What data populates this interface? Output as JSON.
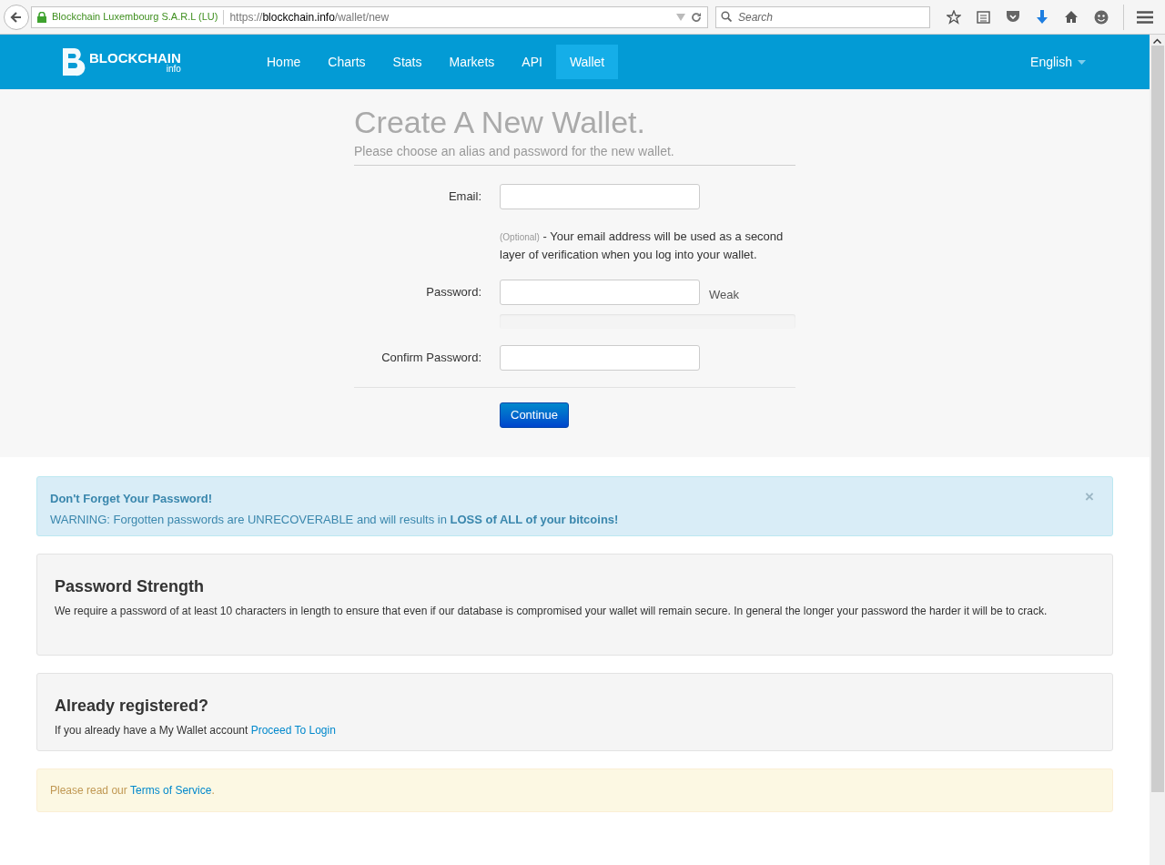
{
  "browser": {
    "identity": "Blockchain Luxembourg S.A.R.L (LU)",
    "url": {
      "scheme": "https://",
      "host": "blockchain.info",
      "path": "/wallet/new"
    },
    "search": {
      "placeholder": "Search"
    }
  },
  "navbar": {
    "logo": {
      "name": "BLOCKCHAIN",
      "sub": "info"
    },
    "items": [
      {
        "label": "Home",
        "selected": false
      },
      {
        "label": "Charts",
        "selected": false
      },
      {
        "label": "Stats",
        "selected": false
      },
      {
        "label": "Markets",
        "selected": false
      },
      {
        "label": "API",
        "selected": false
      },
      {
        "label": "Wallet",
        "selected": true
      }
    ],
    "language": "English"
  },
  "form": {
    "title": "Create A New Wallet.",
    "subtitle": "Please choose an alias and password for the new wallet.",
    "email_label": "Email:",
    "email_hint_tag": "(Optional)",
    "email_hint": "- Your email address will be used as a second layer of verification when you log into your wallet.",
    "password_label": "Password:",
    "strength": "Weak",
    "confirm_label": "Confirm Password:",
    "submit": "Continue"
  },
  "alert": {
    "title": "Don't Forget Your Password!",
    "text": "WARNING: Forgotten passwords are UNRECOVERABLE and will results in **LOSS of ALL of your bitcoins!**",
    "close": "×"
  },
  "strength_panel": {
    "title": "Password Strength",
    "text": "We require a password of at least 10 characters in length to ensure that even if our database is compromised your wallet will remain secure. In general the longer your password the harder it will be to crack."
  },
  "login_panel": {
    "title": "Already registered?",
    "text": "If you already have a My Wallet account",
    "link": "Proceed To Login"
  },
  "terms": {
    "text": "Please read our",
    "link": "Terms of Service",
    "end": "."
  }
}
